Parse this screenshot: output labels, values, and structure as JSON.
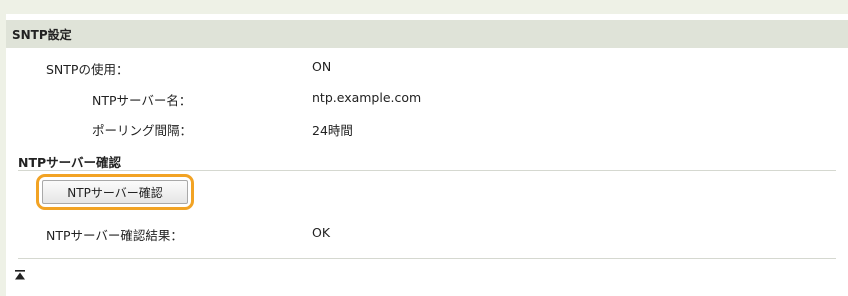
{
  "section": {
    "title": "SNTP設定"
  },
  "settings": {
    "sntp_use_label": "SNTPの使用：",
    "sntp_use_value": "ON",
    "ntp_server_name_label": "NTPサーバー名：",
    "ntp_server_name_value": "ntp.example.com",
    "polling_interval_label": "ポーリング間隔：",
    "polling_interval_value": "24時間"
  },
  "ntp_check": {
    "title": "NTPサーバー確認",
    "button_label": "NTPサーバー確認",
    "result_label": "NTPサーバー確認結果：",
    "result_value": "OK"
  },
  "icons": {
    "back_to_top": "back-to-top-icon"
  },
  "colors": {
    "highlight": "#f2a324",
    "header_bg": "#dfe3d8",
    "page_bg": "#eef1e6"
  }
}
